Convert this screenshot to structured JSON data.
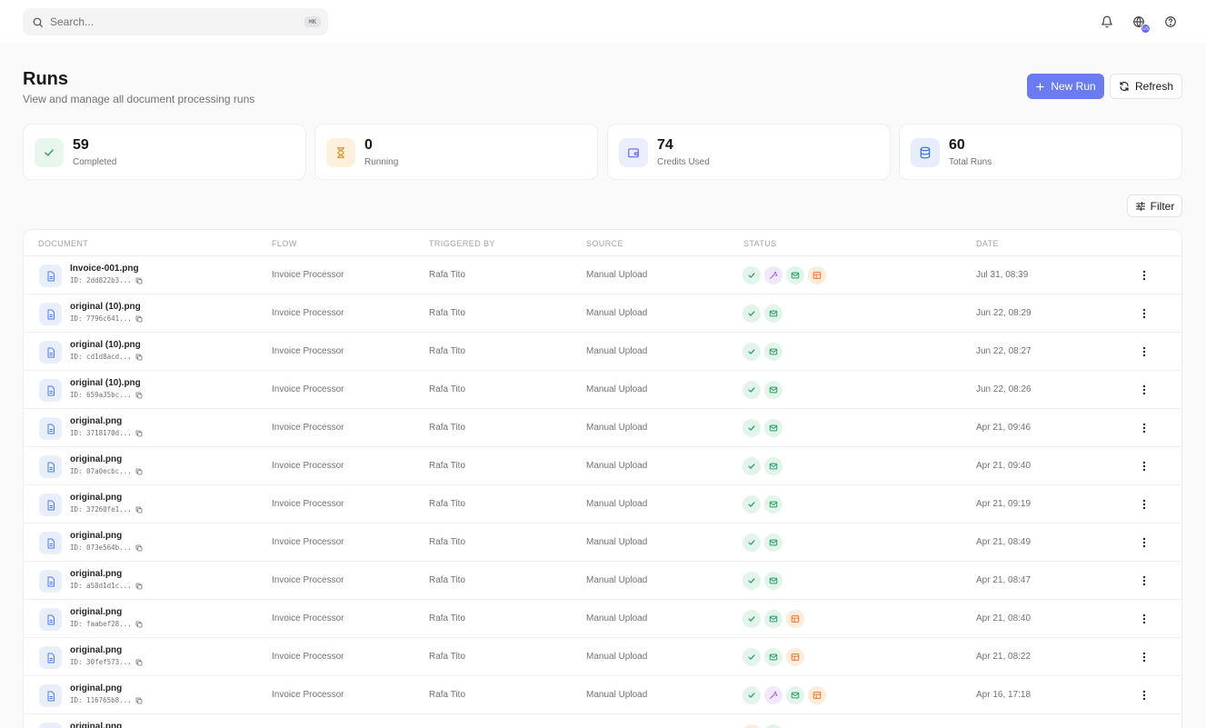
{
  "search": {
    "placeholder": "Search...",
    "shortcut": "⌘K"
  },
  "topbar": {
    "notification_icon": "bell-icon",
    "language_icon": "globe-icon",
    "language_badge": "US",
    "help_icon": "help-circle-icon"
  },
  "header": {
    "title": "Runs",
    "subtitle": "View and manage all document processing runs"
  },
  "actions": {
    "new_run_label": "New Run",
    "refresh_label": "Refresh",
    "filter_label": "Filter"
  },
  "stats": [
    {
      "value": "59",
      "label": "Completed",
      "icon": "check-icon",
      "color": "#22a060",
      "bg": "#e8f6ee"
    },
    {
      "value": "0",
      "label": "Running",
      "icon": "hourglass-icon",
      "color": "#e0922a",
      "bg": "#fdf1de"
    },
    {
      "value": "74",
      "label": "Credits Used",
      "icon": "wallet-icon",
      "color": "#6366f1",
      "bg": "#eceefd"
    },
    {
      "value": "60",
      "label": "Total Runs",
      "icon": "database-icon",
      "color": "#3b6fd8",
      "bg": "#e6eefb"
    }
  ],
  "table": {
    "columns": [
      "DOCUMENT",
      "FLOW",
      "TRIGGERED BY",
      "SOURCE",
      "STATUS",
      "DATE"
    ],
    "rows": [
      {
        "name": "Invoice-001.png",
        "id": "ID: 2dd822b3...",
        "flow": "Invoice Processor",
        "triggered_by": "Rafa Tito",
        "source": "Manual Upload",
        "status": [
          "completed",
          "ai",
          "email",
          "table"
        ],
        "date": "Jul 31, 08:39"
      },
      {
        "name": "original (10).png",
        "id": "ID: 7796c641...",
        "flow": "Invoice Processor",
        "triggered_by": "Rafa Tito",
        "source": "Manual Upload",
        "status": [
          "completed",
          "email"
        ],
        "date": "Jun 22, 08:29"
      },
      {
        "name": "original (10).png",
        "id": "ID: cd1d8acd...",
        "flow": "Invoice Processor",
        "triggered_by": "Rafa Tito",
        "source": "Manual Upload",
        "status": [
          "completed",
          "email"
        ],
        "date": "Jun 22, 08:27"
      },
      {
        "name": "original (10).png",
        "id": "ID: 659a35bc...",
        "flow": "Invoice Processor",
        "triggered_by": "Rafa Tito",
        "source": "Manual Upload",
        "status": [
          "completed",
          "email"
        ],
        "date": "Jun 22, 08:26"
      },
      {
        "name": "original.png",
        "id": "ID: 3718170d...",
        "flow": "Invoice Processor",
        "triggered_by": "Rafa Tito",
        "source": "Manual Upload",
        "status": [
          "completed",
          "email"
        ],
        "date": "Apr 21, 09:46"
      },
      {
        "name": "original.png",
        "id": "ID: 07a0ecbc...",
        "flow": "Invoice Processor",
        "triggered_by": "Rafa Tito",
        "source": "Manual Upload",
        "status": [
          "completed",
          "email"
        ],
        "date": "Apr 21, 09:40"
      },
      {
        "name": "original.png",
        "id": "ID: 37260fe1...",
        "flow": "Invoice Processor",
        "triggered_by": "Rafa Tito",
        "source": "Manual Upload",
        "status": [
          "completed",
          "email"
        ],
        "date": "Apr 21, 09:19"
      },
      {
        "name": "original.png",
        "id": "ID: 073e564b...",
        "flow": "Invoice Processor",
        "triggered_by": "Rafa Tito",
        "source": "Manual Upload",
        "status": [
          "completed",
          "email"
        ],
        "date": "Apr 21, 08:49"
      },
      {
        "name": "original.png",
        "id": "ID: a58d1d1c...",
        "flow": "Invoice Processor",
        "triggered_by": "Rafa Tito",
        "source": "Manual Upload",
        "status": [
          "completed",
          "email"
        ],
        "date": "Apr 21, 08:47"
      },
      {
        "name": "original.png",
        "id": "ID: faabef28...",
        "flow": "Invoice Processor",
        "triggered_by": "Rafa Tito",
        "source": "Manual Upload",
        "status": [
          "completed",
          "email",
          "table"
        ],
        "date": "Apr 21, 08:40"
      },
      {
        "name": "original.png",
        "id": "ID: 30fef573...",
        "flow": "Invoice Processor",
        "triggered_by": "Rafa Tito",
        "source": "Manual Upload",
        "status": [
          "completed",
          "email",
          "table"
        ],
        "date": "Apr 21, 08:22"
      },
      {
        "name": "original.png",
        "id": "ID: 116765b8...",
        "flow": "Invoice Processor",
        "triggered_by": "Rafa Tito",
        "source": "Manual Upload",
        "status": [
          "completed",
          "ai",
          "email",
          "table"
        ],
        "date": "Apr 16, 17:18"
      },
      {
        "name": "original.png",
        "id": "",
        "flow": "",
        "triggered_by": "",
        "source": "",
        "status": [
          "table",
          "email"
        ],
        "date": ""
      }
    ]
  }
}
